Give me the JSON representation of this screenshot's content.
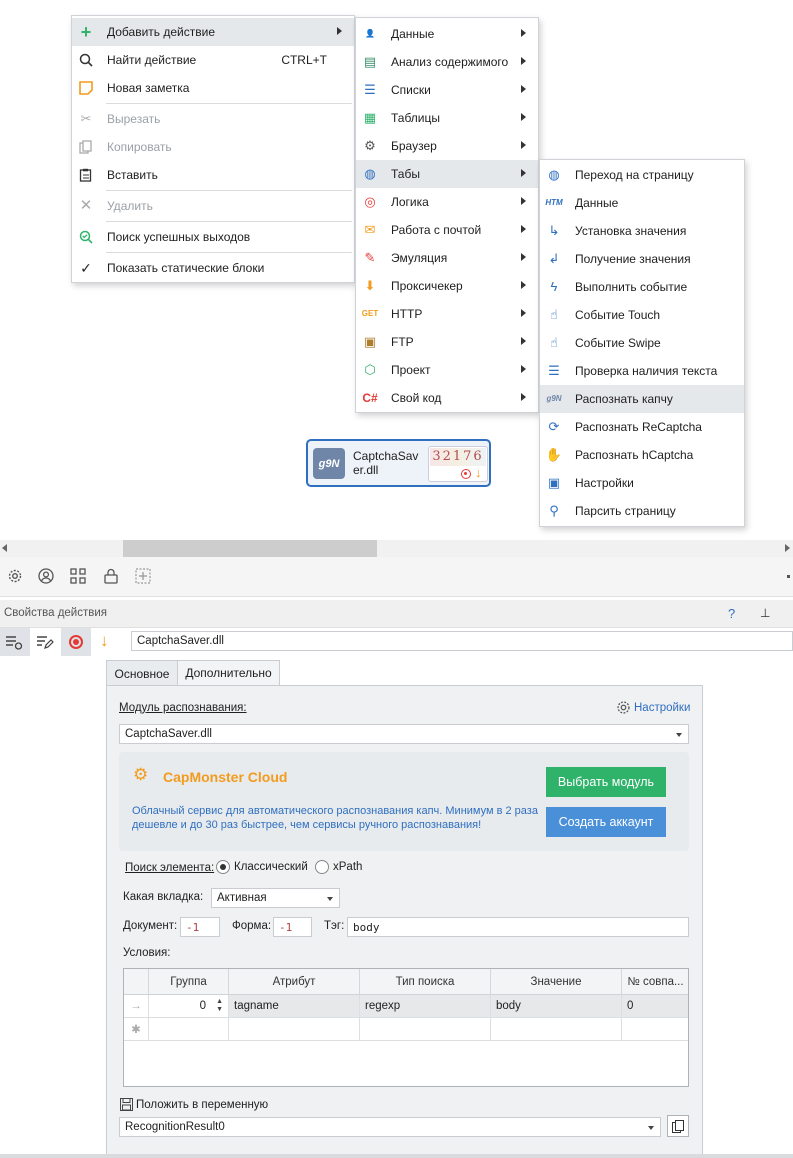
{
  "context_menu": {
    "items": [
      {
        "label": "Добавить действие",
        "shortcut": "",
        "icon": "plus-icon"
      },
      {
        "label": "Найти действие",
        "shortcut": "CTRL+T",
        "icon": "search-icon"
      },
      {
        "label": "Новая заметка",
        "shortcut": "",
        "icon": "note-icon"
      },
      {
        "label": "Вырезать",
        "shortcut": "",
        "icon": "scissors-icon"
      },
      {
        "label": "Копировать",
        "shortcut": "",
        "icon": "copy-icon"
      },
      {
        "label": "Вставить",
        "shortcut": "",
        "icon": "paste-icon"
      },
      {
        "label": "Удалить",
        "shortcut": "",
        "icon": "delete-icon"
      },
      {
        "label": "Поиск успешных выходов",
        "shortcut": "",
        "icon": "search-check-icon"
      },
      {
        "label": "Показать статические блоки",
        "shortcut": "",
        "icon": "checkmark-icon"
      }
    ]
  },
  "submenu_actions": {
    "items": [
      "Данные",
      "Анализ содержимого",
      "Списки",
      "Таблицы",
      "Браузер",
      "Табы",
      "Логика",
      "Работа с почтой",
      "Эмуляция",
      "Проксичекер",
      "HTTP",
      "FTP",
      "Проект",
      "Свой код"
    ]
  },
  "submenu_tabs": {
    "items": [
      "Переход на страницу",
      "Данные",
      "Установка значения",
      "Получение значения",
      "Выполнить событие",
      "Событие Touch",
      "Событие Swipe",
      "Проверка наличия текста",
      "Распознать капчу",
      "Распознать ReCaptcha",
      "Распознать hCaptcha",
      "Настройки",
      "Парсить страницу"
    ]
  },
  "node": {
    "title": "CaptchaSaver.dll",
    "captcha_text": "32176"
  },
  "properties": {
    "header": "Свойства действия",
    "help": "?",
    "pin": "⊥",
    "action_name": "CaptchaSaver.dll",
    "tabs": [
      "Основное",
      "Дополнительно"
    ],
    "module_label": "Модуль распознавания:",
    "settings_link": "Настройки",
    "module_value": "CaptchaSaver.dll",
    "capmonster": {
      "title": "CapMonster Cloud",
      "description": "Облачный сервис для автоматического распознавания капч. Минимум в 2 раза дешевле и до 30 раз быстрее, чем сервисы ручного распознавания!",
      "choose_button": "Выбрать модуль",
      "create_button": "Создать аккаунт"
    },
    "search_label": "Поиск элемента:",
    "radio_classic": "Классический",
    "radio_xpath": "xPath",
    "tab_label": "Какая вкладка:",
    "tab_value": "Активная",
    "doc_label": "Документ:",
    "doc_value": "-1",
    "form_label": "Форма:",
    "form_value": "-1",
    "tag_label": "Тэг:",
    "tag_value": "body",
    "conditions_label": "Условия:",
    "columns": [
      "Группа",
      "Атрибут",
      "Тип поиска",
      "Значение",
      "№ совпа..."
    ],
    "rows": [
      {
        "group": "0",
        "attribute": "tagname",
        "search_type": "regexp",
        "value": "body",
        "match": "0"
      }
    ],
    "save_label": "Положить в переменную",
    "save_value": "RecognitionResult0"
  },
  "colors": {
    "accent": "#2f6fbf",
    "green": "#2fb36b",
    "blue": "#4a90d9",
    "orange": "#f29b1d",
    "record": "#e53935"
  }
}
